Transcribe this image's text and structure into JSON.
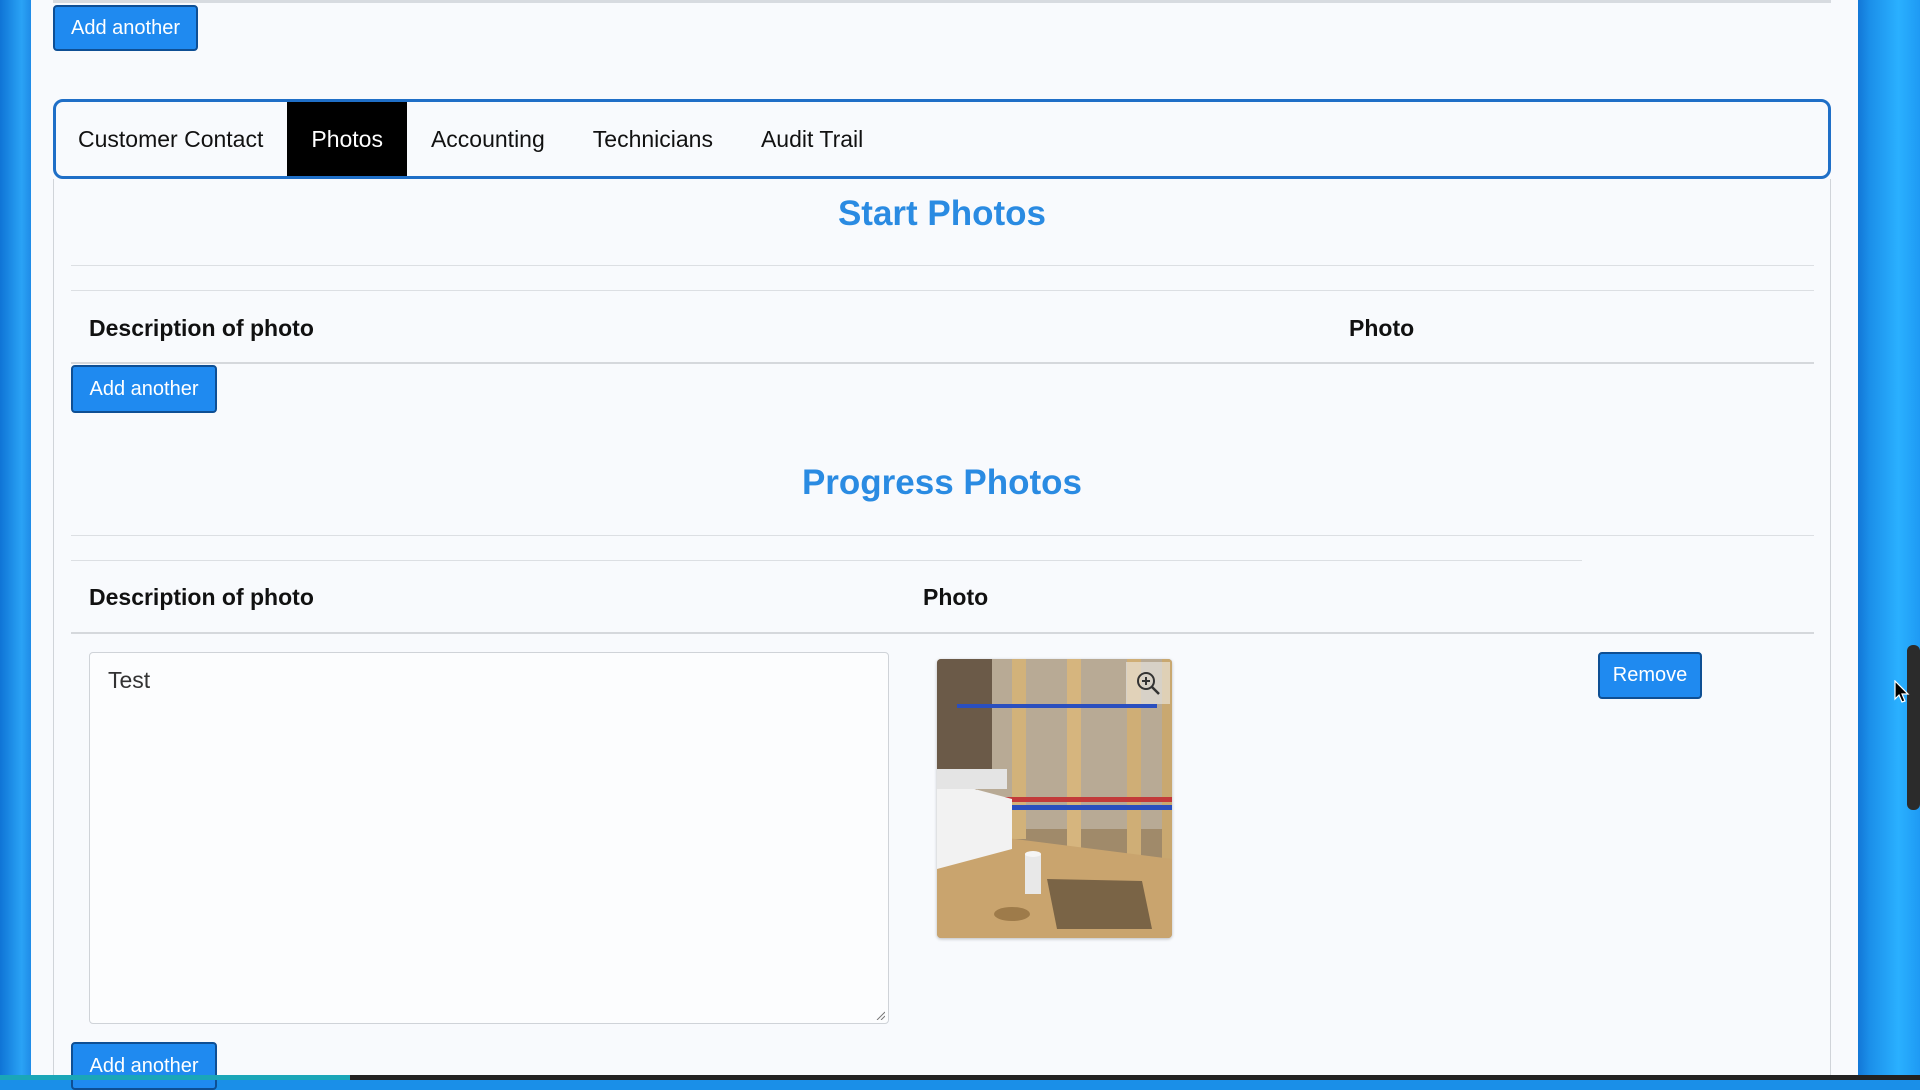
{
  "top": {
    "add_another_label": "Add another"
  },
  "tabs": [
    {
      "label": "Customer Contact",
      "active": false
    },
    {
      "label": "Photos",
      "active": true
    },
    {
      "label": "Accounting",
      "active": false
    },
    {
      "label": "Technicians",
      "active": false
    },
    {
      "label": "Audit Trail",
      "active": false
    }
  ],
  "start_photos": {
    "title": "Start Photos",
    "columns": [
      "Description of photo",
      "Photo"
    ],
    "add_another_label": "Add another"
  },
  "progress_photos": {
    "title": "Progress Photos",
    "columns": [
      "Description of photo",
      "Photo"
    ],
    "rows": [
      {
        "description": "Test",
        "photo": {
          "alt": "construction-photo",
          "zoom_icon": "zoom-in-icon"
        },
        "remove_label": "Remove"
      }
    ],
    "add_another_label": "Add another"
  },
  "colors": {
    "accent": "#1f8af0",
    "heading": "#2a8be2",
    "tab_active_bg": "#000000",
    "tab_border": "#1f6fc7",
    "background_blue": "#1a8fe8"
  }
}
